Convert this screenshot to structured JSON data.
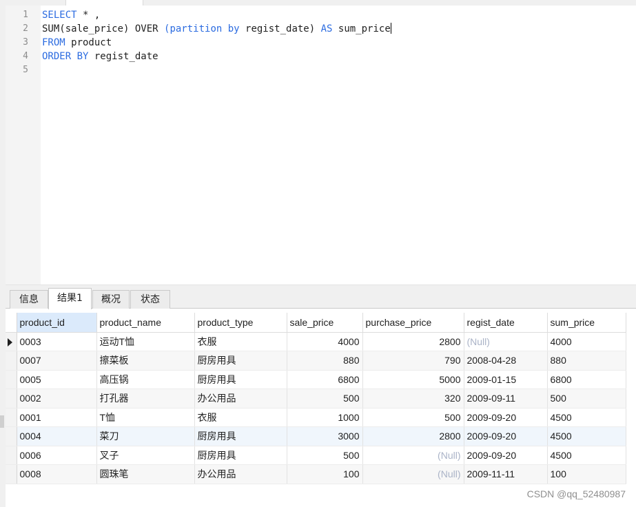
{
  "editor": {
    "lines": [
      {
        "num": "1",
        "segments": [
          {
            "t": "SELECT",
            "kw": true
          },
          {
            "t": " * ,"
          }
        ]
      },
      {
        "num": "2",
        "segments": [
          {
            "t": "SUM(sale_price) OVER "
          },
          {
            "t": "(partition by",
            "kw": true
          },
          {
            "t": " regist_date) "
          },
          {
            "t": "AS",
            "kw": true
          },
          {
            "t": " sum_price"
          }
        ]
      },
      {
        "num": "3",
        "segments": [
          {
            "t": "FROM",
            "kw": true
          },
          {
            "t": " product"
          }
        ]
      },
      {
        "num": "4",
        "segments": [
          {
            "t": "ORDER BY",
            "kw": true
          },
          {
            "t": " regist_date"
          }
        ]
      },
      {
        "num": "5",
        "segments": []
      }
    ]
  },
  "result_tabs": [
    {
      "label": "信息",
      "active": false
    },
    {
      "label": "结果1",
      "active": true
    },
    {
      "label": "概况",
      "active": false
    },
    {
      "label": "状态",
      "active": false
    }
  ],
  "grid": {
    "columns": [
      "product_id",
      "product_name",
      "product_type",
      "sale_price",
      "purchase_price",
      "regist_date",
      "sum_price"
    ],
    "selected_column": "product_id",
    "current_row": 0,
    "highlighted_row": 5,
    "null_text": "(Null)",
    "rows": [
      [
        "0003",
        "运动T恤",
        "衣服",
        "4000",
        "2800",
        null,
        "4000"
      ],
      [
        "0007",
        "擦菜板",
        "厨房用具",
        "880",
        "790",
        "2008-04-28",
        "880"
      ],
      [
        "0005",
        "高压锅",
        "厨房用具",
        "6800",
        "5000",
        "2009-01-15",
        "6800"
      ],
      [
        "0002",
        "打孔器",
        "办公用品",
        "500",
        "320",
        "2009-09-11",
        "500"
      ],
      [
        "0001",
        "T恤",
        "衣服",
        "1000",
        "500",
        "2009-09-20",
        "4500"
      ],
      [
        "0004",
        "菜刀",
        "厨房用具",
        "3000",
        "2800",
        "2009-09-20",
        "4500"
      ],
      [
        "0006",
        "叉子",
        "厨房用具",
        "500",
        null,
        "2009-09-20",
        "4500"
      ],
      [
        "0008",
        "圆珠笔",
        "办公用品",
        "100",
        null,
        "2009-11-11",
        "100"
      ]
    ]
  },
  "watermark": "CSDN @qq_52480987",
  "colors": {
    "keyword": "#2b6be0",
    "null": "#aab3c7",
    "selected_header": "#dbeafb"
  }
}
